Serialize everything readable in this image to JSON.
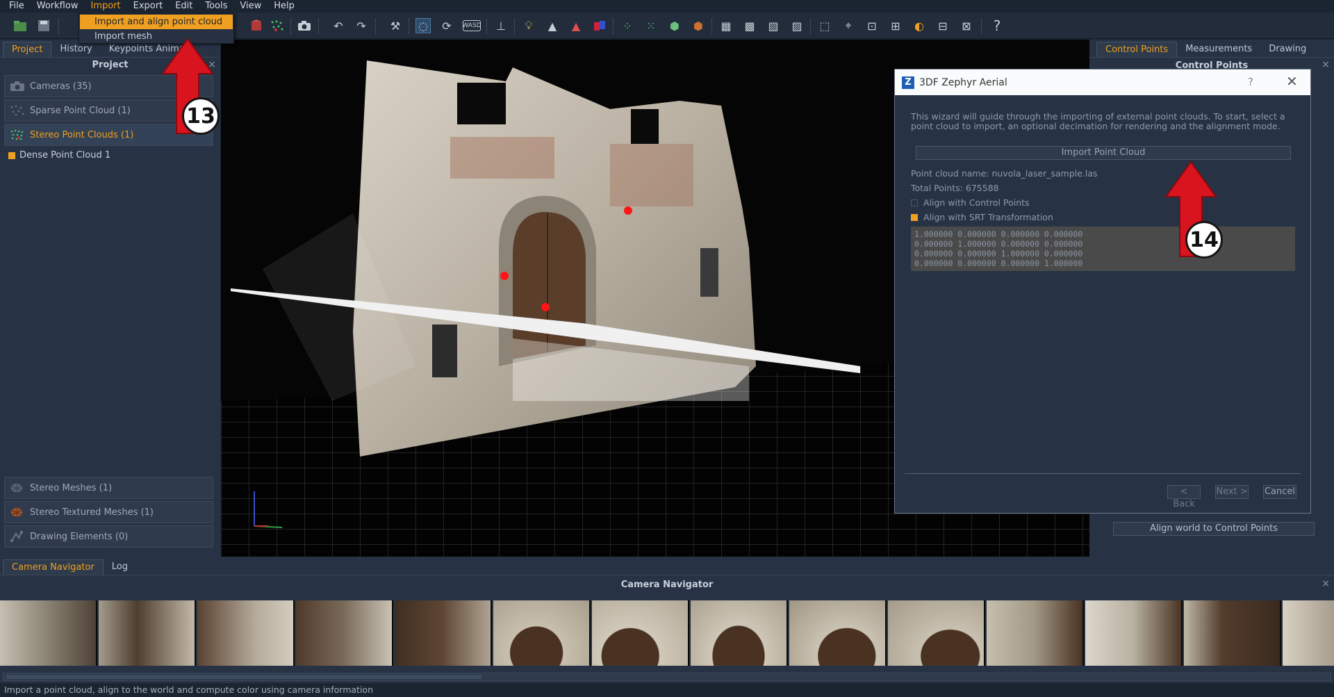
{
  "menubar": {
    "items": [
      "File",
      "Workflow",
      "Import",
      "Export",
      "Edit",
      "Tools",
      "View",
      "Help"
    ]
  },
  "import_menu": {
    "items": [
      "Import and align point cloud",
      "Import mesh"
    ]
  },
  "left_panel": {
    "tabs": [
      "Project",
      "History",
      "Keypoints Anima"
    ],
    "title": "Project",
    "sections_top": [
      {
        "label": "Cameras (35)",
        "icon": "camera-icon"
      },
      {
        "label": "Sparse Point Cloud (1)",
        "icon": "sparse-cloud-icon"
      },
      {
        "label": "Stereo Point Clouds (1)",
        "icon": "dense-cloud-icon"
      }
    ],
    "tree_item": "Dense Point Cloud 1",
    "sections_bottom": [
      {
        "label": "Stereo Meshes (1)",
        "icon": "mesh-icon"
      },
      {
        "label": "Stereo Textured Meshes (1)",
        "icon": "textured-mesh-icon"
      },
      {
        "label": "Drawing Elements (0)",
        "icon": "drawing-icon"
      }
    ]
  },
  "right_panel": {
    "tabs": [
      "Control Points",
      "Measurements",
      "Drawing"
    ],
    "title": "Control Points",
    "align_button": "Align world to Control Points"
  },
  "dialog": {
    "title": "3DF Zephyr Aerial",
    "help": "?",
    "intro": "This wizard will guide through the importing of external point clouds. To start, select a point cloud to import, an optional decimation for rendering and the alignment mode.",
    "import_button": "Import Point Cloud",
    "cloud_name": "Point cloud name: nuvola_laser_sample.las",
    "total_points": "Total Points: 675588",
    "align_cp": "Align with Control Points",
    "align_srt": "Align with SRT Transformation",
    "matrix": [
      "1.000000 0.000000 0.000000 0.000000",
      "0.000000 1.000000 0.000000 0.000000",
      "0.000000 0.000000 1.000000 0.000000",
      "0.000000 0.000000 0.000000 1.000000"
    ],
    "back": "< Back",
    "next": "Next >",
    "cancel": "Cancel"
  },
  "bottom": {
    "tabs": [
      "Camera Navigator",
      "Log"
    ],
    "title": "Camera Navigator",
    "status": "Import a point cloud, align to the world and compute color using camera information"
  },
  "annotations": {
    "marker1": "13",
    "marker2": "14",
    "arrow_color": "#d8141e"
  }
}
